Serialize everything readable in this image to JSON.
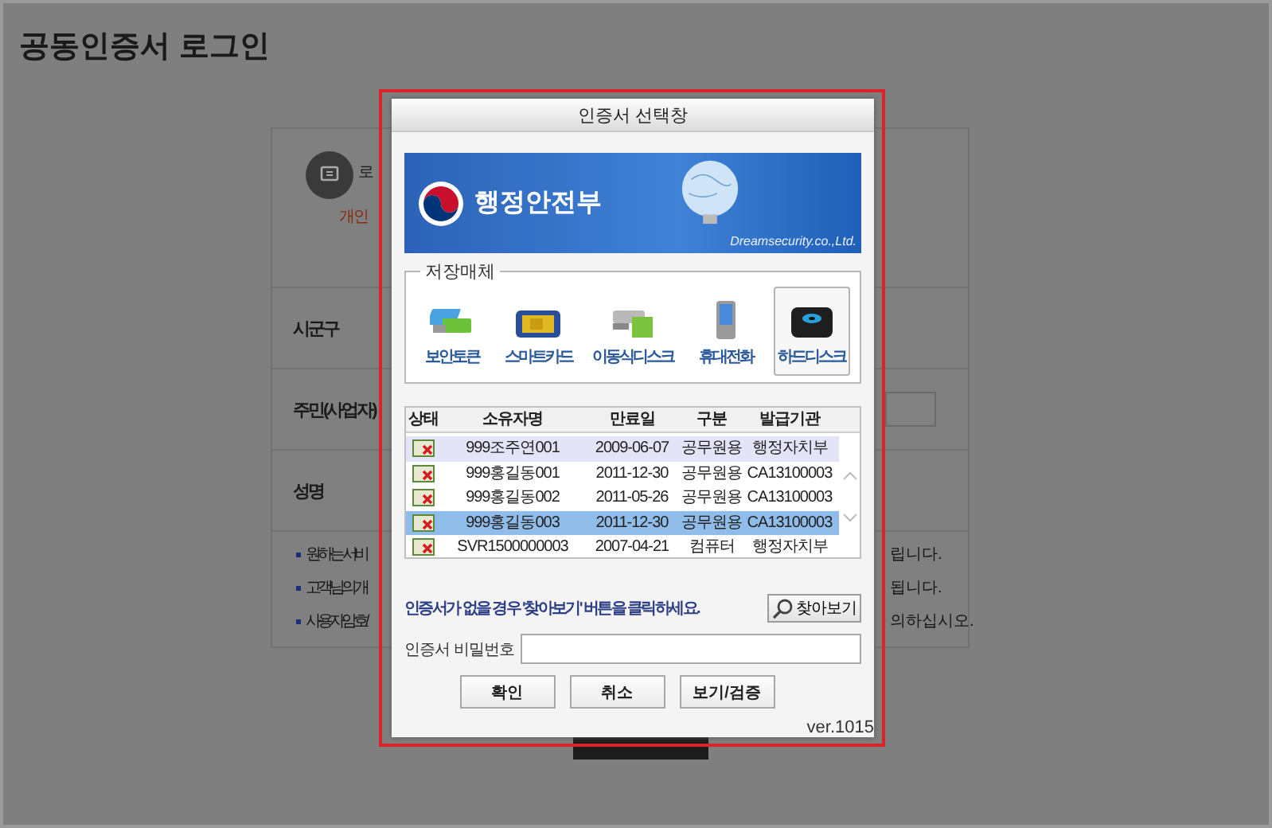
{
  "page": {
    "title": "공동인증서 로그인",
    "notice": {
      "line_1": "로",
      "line_2": "개인"
    },
    "fields": [
      {
        "label": "시군구",
        "has_input": false
      },
      {
        "label": "주민(사업자)",
        "has_input": true
      },
      {
        "label": "성명",
        "has_input": false
      }
    ],
    "bullets": [
      {
        "left": "원하는 서비",
        "right": "립니다."
      },
      {
        "left": "고객님의 개",
        "right": "됩니다."
      },
      {
        "left": "사용자암호/",
        "right": "의하십시오."
      }
    ]
  },
  "dialog": {
    "title": "인증서 선택창",
    "banner": {
      "org": "행정안전부",
      "vendor": "Dreamsecurity.co.,Ltd."
    },
    "storage": {
      "legend": "저장매체",
      "items": [
        {
          "kind": "token",
          "label": "보안토큰",
          "selected": false
        },
        {
          "kind": "smartcard",
          "label": "스마트카드",
          "selected": false
        },
        {
          "kind": "usb",
          "label": "이동식디스크",
          "selected": false
        },
        {
          "kind": "phone",
          "label": "휴대전화",
          "selected": false
        },
        {
          "kind": "harddisk",
          "label": "하드디스크",
          "selected": true
        }
      ]
    },
    "table": {
      "columns": [
        "상태",
        "소유자명",
        "만료일",
        "구분",
        "발급기관"
      ],
      "rows": [
        {
          "cells": [
            "",
            "999조주연001",
            "2009-06-07",
            "공무원용",
            "행정자치부"
          ],
          "selected": false,
          "highlighted": true
        },
        {
          "cells": [
            "",
            "999홍길동001",
            "2011-12-30",
            "공무원용",
            "CA13100003"
          ],
          "selected": false,
          "highlighted": false
        },
        {
          "cells": [
            "",
            "999홍길동002",
            "2011-05-26",
            "공무원용",
            "CA13100003"
          ],
          "selected": false,
          "highlighted": false
        },
        {
          "cells": [
            "",
            "999홍길동003",
            "2011-12-30",
            "공무원용",
            "CA13100003"
          ],
          "selected": true,
          "highlighted": false
        },
        {
          "cells": [
            "",
            "SVR1500000003",
            "2007-04-21",
            "컴퓨터",
            "행정자치부"
          ],
          "selected": false,
          "highlighted": false
        }
      ]
    },
    "hint": "인증서가 없을 경우 '찾아보기' 버튼을 클릭하세요.",
    "browse_button": "찾아보기",
    "password": {
      "label": "인증서 비밀번호"
    },
    "buttons": [
      "확인",
      "취소",
      "보기/검증"
    ],
    "version": "ver.1015"
  }
}
